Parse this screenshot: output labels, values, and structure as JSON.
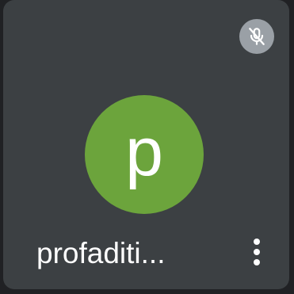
{
  "participant": {
    "name": "profaditi...",
    "avatar_letter": "p",
    "avatar_color": "#6ca43c",
    "mic_status": "muted"
  },
  "icons": {
    "mic": "mic-off-icon",
    "menu": "more-vert-icon"
  },
  "colors": {
    "tile_background": "#3c4043",
    "mic_badge": "#9aa0a6",
    "text": "#ffffff"
  }
}
